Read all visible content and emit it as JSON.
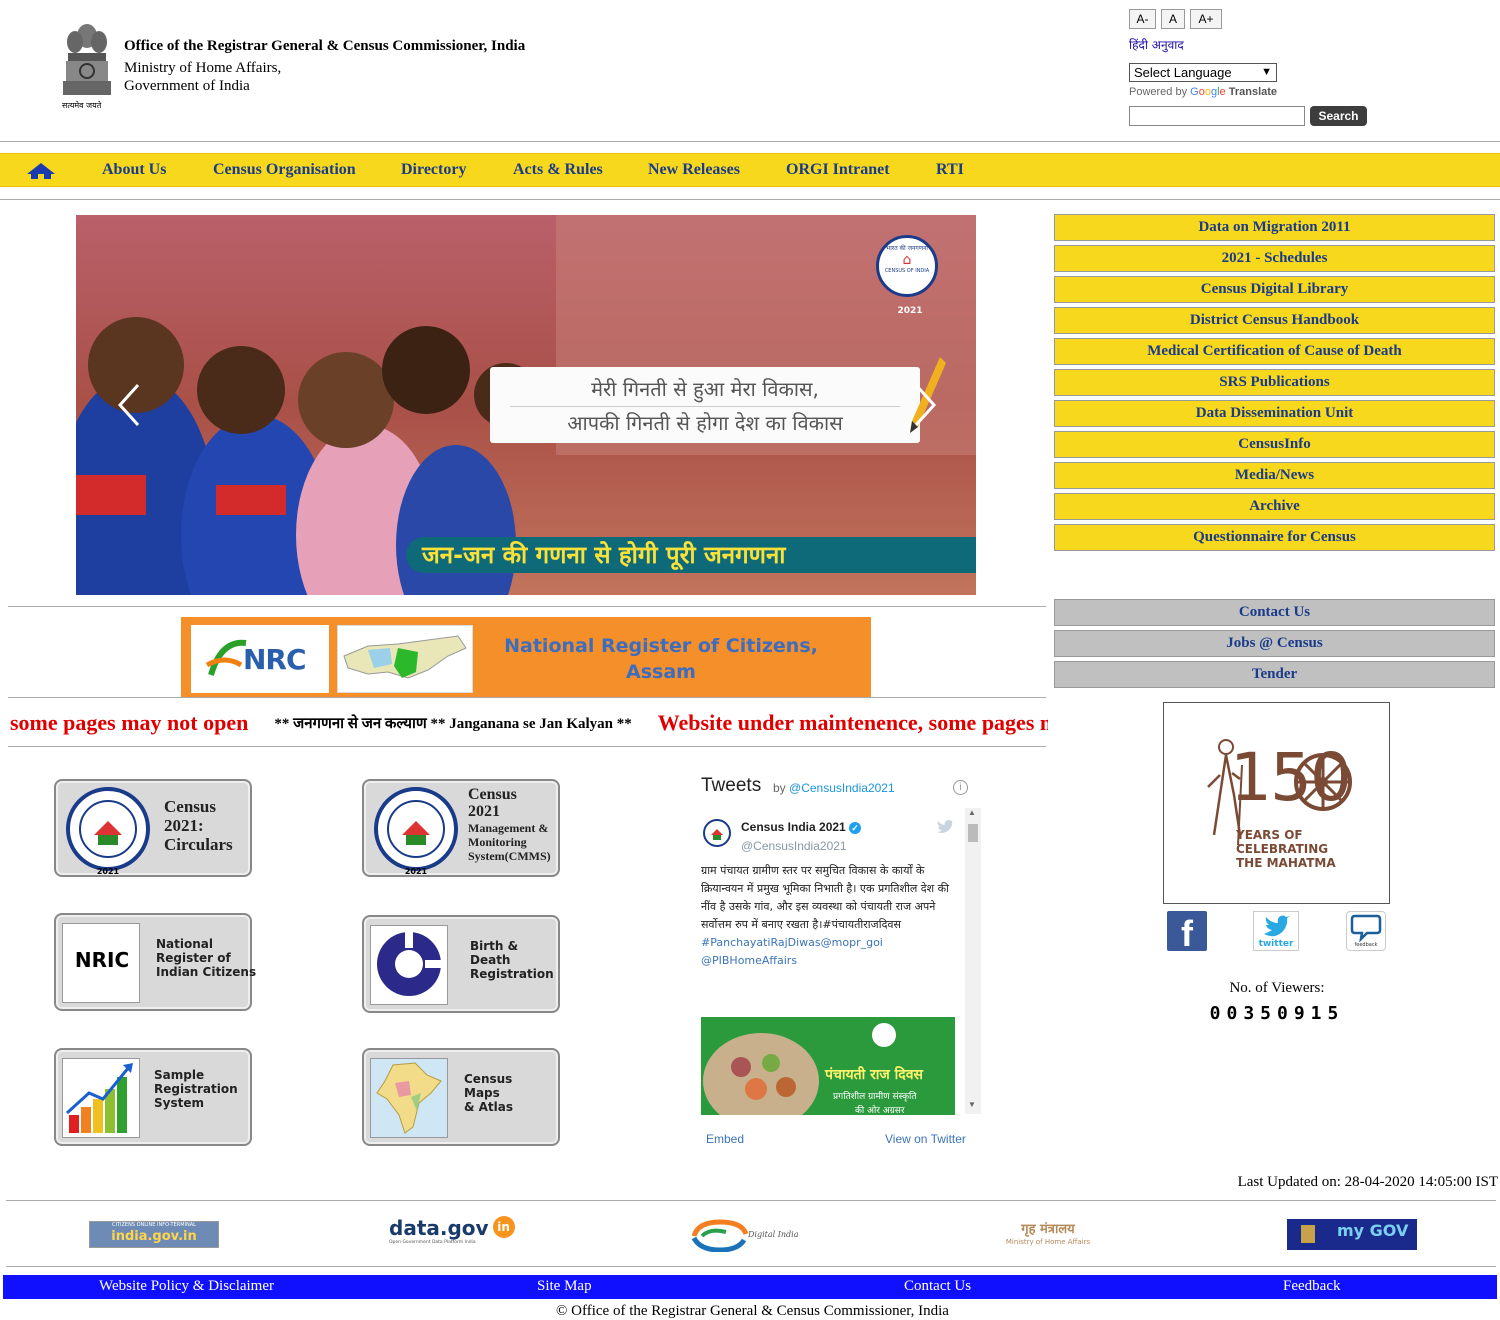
{
  "header": {
    "org_name": "Office of the Registrar General & Census Commissioner, India",
    "ministry": "Ministry of Home Affairs,",
    "government": "Government of India",
    "emblem_caption": "सत्यमेव जयते",
    "font_small": "A-",
    "font_normal": "A",
    "font_large": "A+",
    "hindi_link": "हिंदी अनुवाद",
    "language_select": "Select Language",
    "powered_by": "Powered by",
    "translate": "Translate",
    "search_value": "",
    "search_button": "Search"
  },
  "nav": {
    "items": [
      "About Us",
      "Census Organisation",
      "Directory",
      "Acts & Rules",
      "New Releases",
      "ORGI Intranet",
      "RTI"
    ]
  },
  "banner": {
    "badge_top": "भारत की जनगणना",
    "badge_bottom": "CENSUS OF INDIA",
    "badge_year": "2021",
    "line1": "मेरी गिनती से हुआ मेरा विकास,",
    "line2": "आपकी गिनती से होगा देश का विकास",
    "tagline": "जन-जन की गणना से होगी पूरी जनगणना"
  },
  "right_menu": {
    "yellow": [
      "Data on Migration 2011",
      "2021 - Schedules",
      "Census Digital Library",
      "District Census Handbook",
      "Medical Certification of Cause of Death",
      "SRS Publications",
      "Data Dissemination Unit",
      "CensusInfo",
      "Media/News",
      "Archive",
      "Questionnaire for Census"
    ],
    "grey": [
      "Contact Us",
      "Jobs @ Census",
      "Tender"
    ]
  },
  "nrc": {
    "logo_text": "NRC",
    "title": "National Register of Citizens, Assam"
  },
  "marquee": {
    "red1": "some pages may not open",
    "black": "** जनगणना से जन कल्याण ** Janganana se Jan Kalyan **",
    "red2": "Website under maintenence, some pages may not open"
  },
  "tiles": {
    "circulars": "Census 2021: Circulars",
    "cmms": "Census 2021 Management & Monitoring System(CMMS)",
    "cmms_line1": "Census",
    "cmms_line2": "2021",
    "cmms_line3": "Management &",
    "cmms_line4": "Monitoring",
    "cmms_line5": "System(CMMS)",
    "circ_line1": "Census",
    "circ_line2": "2021:",
    "circ_line3": "Circulars",
    "nric_logo": "NRIC",
    "nric_line1": "National",
    "nric_line2": "Register of",
    "nric_line3": "Indian Citizens",
    "bd_line1": "Birth &",
    "bd_line2": "Death",
    "bd_line3": "Registration",
    "srs_line1": "Sample",
    "srs_line2": "Registration",
    "srs_line3": "System",
    "maps_line1": "Census",
    "maps_line2": "Maps",
    "maps_line3": "& Atlas",
    "badge_year": "2021"
  },
  "tweets": {
    "title": "Tweets",
    "by": "by",
    "by_handle": "@CensusIndia2021",
    "account_name": "Census India 2021",
    "account_handle": "@CensusIndia2021",
    "text": "ग्राम पंचायत ग्रामीण स्तर पर समुचित विकास के कार्यों के क्रियान्वयन में प्रमुख भूमिका निभाती है। एक प्रगतिशील देश की नींव है उसके गांव, और इस व्यवस्था को पंचायती राज अपने सर्वोत्तम रुप में बनाए रखता है।#पंचायतीराजदिवस",
    "tag1": "#PanchayatiRajDiwas@mopr_goi",
    "tag2": "@PIBHomeAffairs",
    "image_title": "पंचायती राज दिवस",
    "image_sub1": "प्रगतिशील ग्रामीण संस्कृति",
    "image_sub2": "की ओर अग्रसर",
    "embed": "Embed",
    "view_on_twitter": "View on Twitter"
  },
  "gandhi": {
    "number": "150",
    "line1": "YEARS OF",
    "line2": "CELEBRATING",
    "line3": "THE MAHATMA"
  },
  "social": {
    "twitter_label": "twitter",
    "feedback_label": "feedback"
  },
  "viewers": {
    "label": "No. of Viewers:",
    "count": "00350915"
  },
  "last_updated": "Last Updated on: 28-04-2020 14:05:00 IST",
  "partners": {
    "indiagov_top": "CITIZENS ONLINE INFO-TERMINAL",
    "indiagov": "india.gov.in",
    "datagov": "data.gov",
    "datagov_in": "in",
    "datagov_sub": "Open Government Data Platform India",
    "digital_india": "Digital India",
    "mha_hindi": "गृह मंत्रालय",
    "mha_en": "Ministry of Home Affairs",
    "mygov": "my GOV"
  },
  "footer": {
    "links": [
      "Website Policy & Disclaimer",
      "Site Map",
      "Contact Us",
      "Feedback"
    ],
    "copyright": "© Office of the Registrar General & Census Commissioner, India"
  },
  "colors": {
    "nav_yellow": "#f7d81c",
    "nav_text": "#1a3b8a",
    "footer_blue": "#1010ff",
    "marquee_red": "#e00000",
    "grey_menu": "#c0c0c0"
  }
}
